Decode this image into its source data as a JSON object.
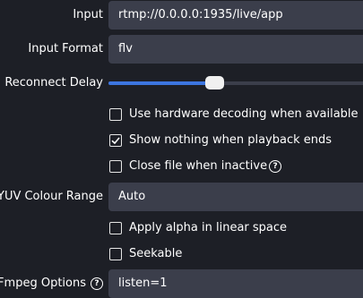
{
  "input": {
    "label": "Input",
    "value": "rtmp://0.0.0.0:1935/live/app"
  },
  "input_format": {
    "label": "Input Format",
    "value": "flv"
  },
  "reconnect_delay": {
    "label": "Reconnect Delay",
    "level": 0.41
  },
  "options": {
    "hw_decoding": {
      "label": "Use hardware decoding when available",
      "checked": false
    },
    "show_nothing": {
      "label": "Show nothing when playback ends",
      "checked": true
    },
    "close_inactive": {
      "label": "Close file when inactive",
      "checked": false,
      "help_icon": "help-icon"
    }
  },
  "yuv_range": {
    "label": "YUV Colour Range",
    "value": "Auto"
  },
  "alpha_linear": {
    "label": "Apply alpha in linear space",
    "checked": false
  },
  "seekable": {
    "label": "Seekable",
    "checked": false
  },
  "ffmpeg_options": {
    "label": "FFmpeg Options",
    "value": "listen=1",
    "help_icon": "help-icon"
  },
  "colors": {
    "background": "#1d1f26",
    "field": "#3b3e4b",
    "accent": "#3c75e0"
  }
}
